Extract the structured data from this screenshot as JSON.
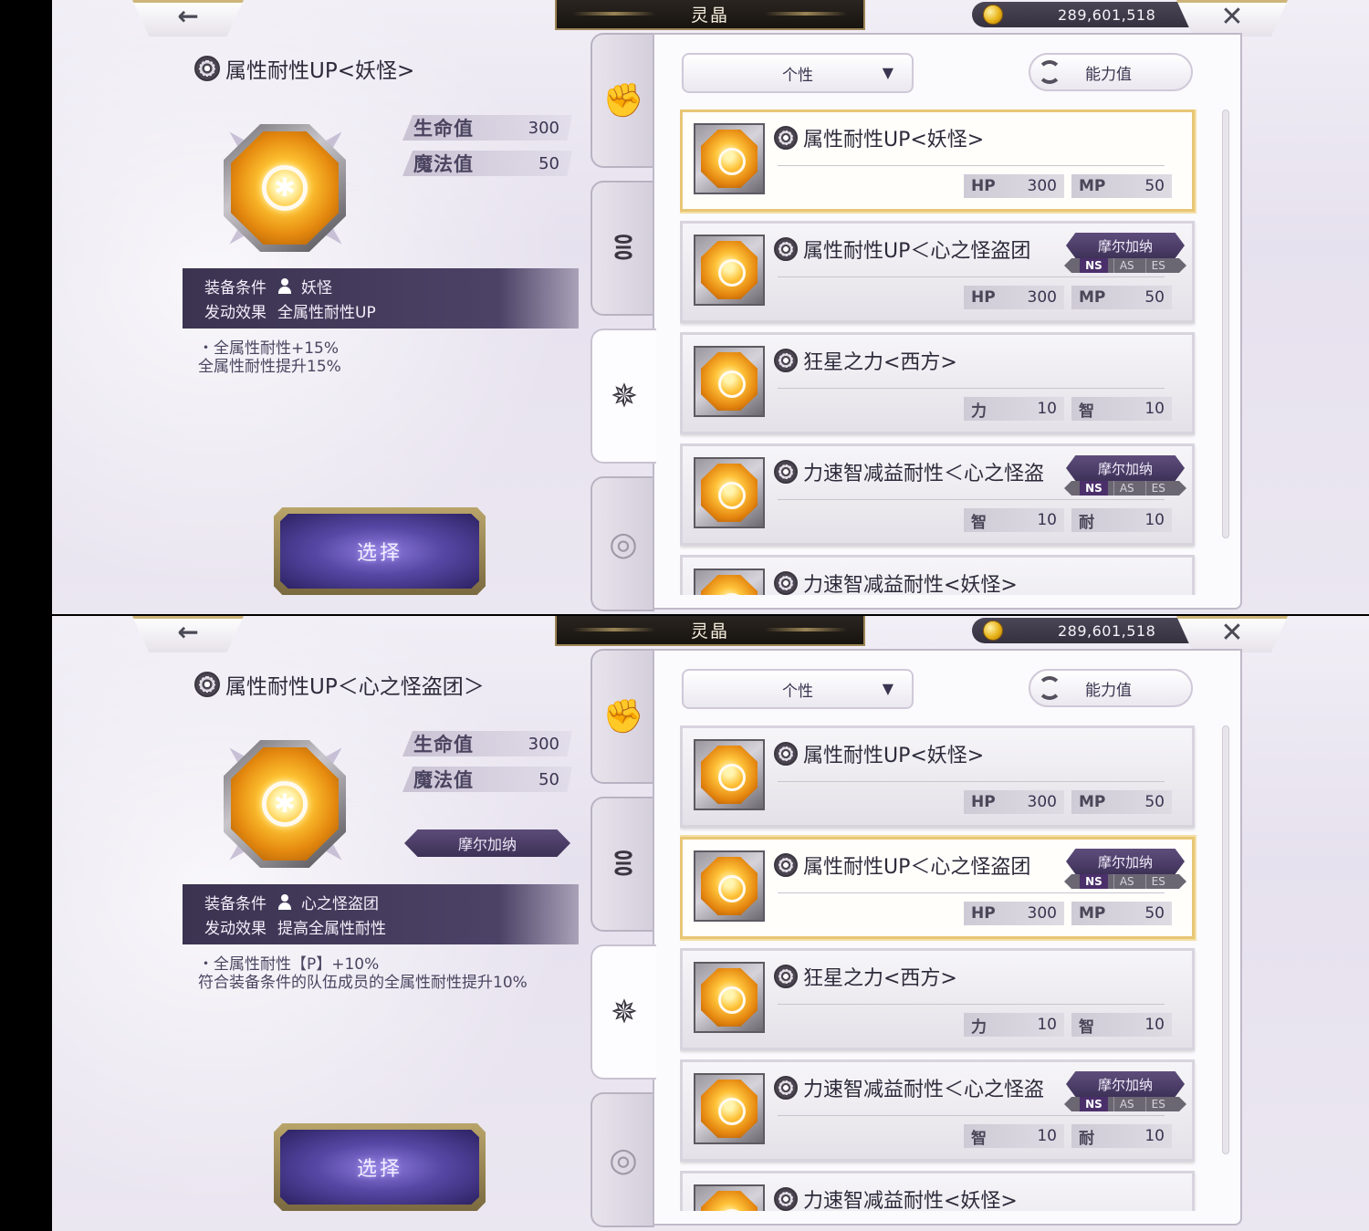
{
  "window": {
    "title": "灵晶",
    "currency": "289,601,518",
    "back_icon": "back-arrow-icon",
    "close_icon": "close-icon"
  },
  "screens": [
    {
      "detail": {
        "name": "属性耐性UP<妖怪>",
        "stats": [
          {
            "label": "生命值",
            "value": "300"
          },
          {
            "label": "魔法值",
            "value": "50"
          }
        ],
        "team_badge": "",
        "condition_label": "装备条件",
        "condition_value": "妖怪",
        "effect_label": "发动效果",
        "effect_value": "全属性耐性UP",
        "description_1": "・全属性耐性+15%",
        "description_2": "全属性耐性提升15%",
        "select_label": "选择"
      },
      "selected_index": 0
    },
    {
      "detail": {
        "name": "属性耐性UP＜心之怪盗团＞",
        "stats": [
          {
            "label": "生命值",
            "value": "300"
          },
          {
            "label": "魔法值",
            "value": "50"
          }
        ],
        "team_badge": "摩尔加纳",
        "condition_label": "装备条件",
        "condition_value": "心之怪盗团",
        "effect_label": "发动效果",
        "effect_value": "提高全属性耐性",
        "description_1": "・全属性耐性【P】+10%",
        "description_2": "符合装备条件的队伍成员的全属性耐性提升10%",
        "select_label": "选择"
      },
      "selected_index": 1
    }
  ],
  "list": {
    "sort_filter": "个性",
    "sort_key": "能力值",
    "category_tabs": [
      "fist-icon",
      "swirl-icon",
      "gear-emblem-icon",
      "spiral-icon"
    ],
    "active_tab": 2,
    "items": [
      {
        "name": "属性耐性UP<妖怪>",
        "badge": "",
        "stats": [
          {
            "k": "HP",
            "v": "300"
          },
          {
            "k": "MP",
            "v": "50"
          }
        ]
      },
      {
        "name": "属性耐性UP＜心之怪盗团",
        "badge": "摩尔加纳",
        "stats": [
          {
            "k": "HP",
            "v": "300"
          },
          {
            "k": "MP",
            "v": "50"
          }
        ]
      },
      {
        "name": "狂星之力<西方>",
        "badge": "",
        "stats": [
          {
            "k": "力",
            "v": "10"
          },
          {
            "k": "智",
            "v": "10"
          }
        ]
      },
      {
        "name": "力速智减益耐性＜心之怪盗",
        "badge": "摩尔加纳",
        "stats": [
          {
            "k": "智",
            "v": "10"
          },
          {
            "k": "耐",
            "v": "10"
          }
        ]
      },
      {
        "name": "力速智减益耐性<妖怪>",
        "badge": "",
        "stats": [
          {
            "k": "",
            "v": ""
          },
          {
            "k": "",
            "v": ""
          }
        ]
      }
    ],
    "tiers": [
      "NS",
      "AS",
      "ES"
    ],
    "active_tier": "NS"
  }
}
